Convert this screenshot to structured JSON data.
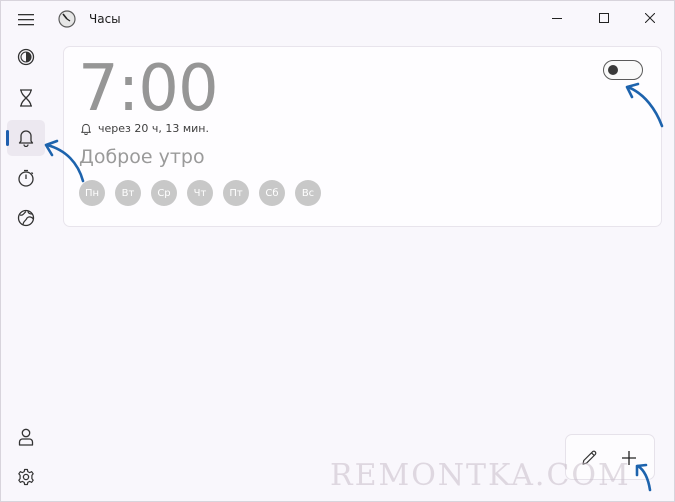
{
  "window": {
    "title": "Часы",
    "controls": [
      "minimize-icon",
      "maximize-icon",
      "close-icon"
    ]
  },
  "sidebar": {
    "items": [
      {
        "name": "menu",
        "icon": "hamburger-icon"
      },
      {
        "name": "focus",
        "icon": "focus-icon"
      },
      {
        "name": "timer",
        "icon": "hourglass-icon"
      },
      {
        "name": "alarm",
        "icon": "bell-icon",
        "active": true
      },
      {
        "name": "stopwatch",
        "icon": "stopwatch-icon"
      },
      {
        "name": "world-clock",
        "icon": "globe-icon"
      },
      {
        "name": "account",
        "icon": "person-icon"
      },
      {
        "name": "settings",
        "icon": "gear-icon"
      }
    ]
  },
  "alarm": {
    "time": "7:00",
    "remaining": "через 20 ч, 13 мин.",
    "name": "Доброе утро",
    "enabled": false,
    "days": [
      "Пн",
      "Вт",
      "Ср",
      "Чт",
      "Пт",
      "Сб",
      "Вс"
    ]
  },
  "actions": {
    "edit_icon": "pencil-icon",
    "add_icon": "plus-icon"
  },
  "watermark": "REMONTKA.COM",
  "colors": {
    "accent": "#1f5fae",
    "day_inactive": "#c8c8c8",
    "time_text": "#969696",
    "annotation_arrow": "#1d63ad"
  }
}
